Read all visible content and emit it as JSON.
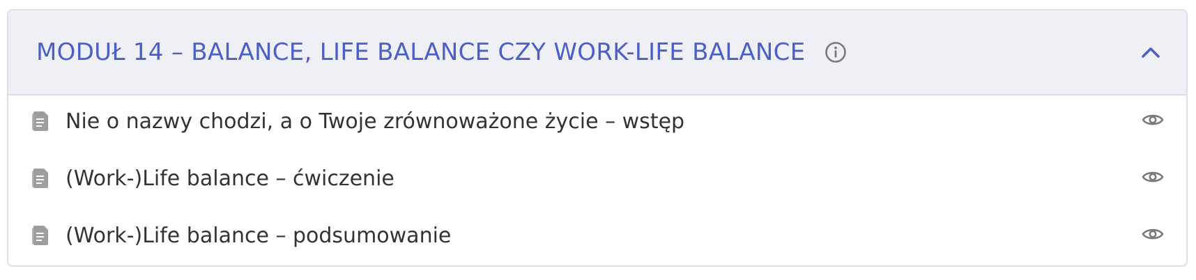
{
  "module": {
    "title": "MODUŁ 14 – BALANCE, LIFE BALANCE CZY WORK-LIFE BALANCE",
    "info_icon": "info-circle-icon",
    "toggle_icon": "chevron-up-icon",
    "expanded": true
  },
  "lessons": [
    {
      "title": "Nie o nazwy chodzi, a o Twoje zrównoważone życie – wstęp",
      "icon": "document-icon",
      "action_icon": "eye-icon"
    },
    {
      "title": "(Work-)Life balance – ćwiczenie",
      "icon": "document-icon",
      "action_icon": "eye-icon"
    },
    {
      "title": "(Work-)Life balance – podsumowanie",
      "icon": "document-icon",
      "action_icon": "eye-icon"
    }
  ],
  "colors": {
    "accent": "#4a5fc7",
    "header_bg": "#eff0f6",
    "border": "#dddfe6",
    "text": "#333333",
    "icon_gray": "#7a7a7a",
    "doc_gray": "#9e9e9e"
  }
}
